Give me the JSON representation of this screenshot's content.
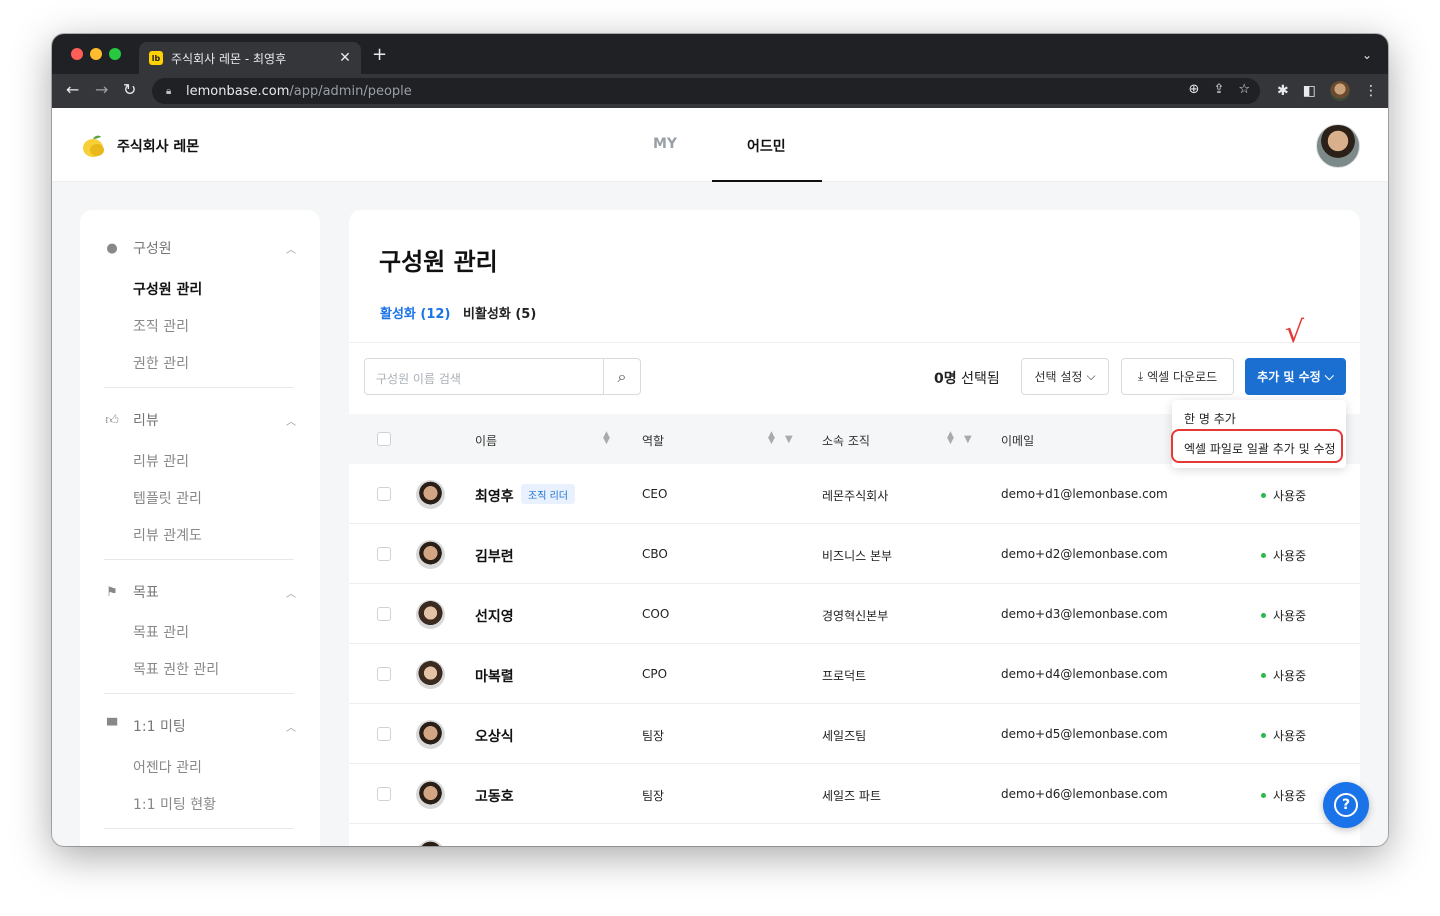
{
  "browser": {
    "tab_title": "주식회사 레몬 - 최영후",
    "tab_favicon": "lb",
    "url_host": "lemonbase.com",
    "url_path": "/app/admin/people"
  },
  "header": {
    "company": "주식회사 레몬",
    "nav": [
      {
        "label": "MY",
        "active": false
      },
      {
        "label": "어드민",
        "active": true
      }
    ]
  },
  "sidebar": {
    "sections": [
      {
        "label": "구성원",
        "icon": "person-icon",
        "items": [
          "구성원 관리",
          "조직 관리",
          "권한 관리"
        ],
        "active_item": 0
      },
      {
        "label": "리뷰",
        "icon": "thumbs-up-icon",
        "items": [
          "리뷰 관리",
          "템플릿 관리",
          "리뷰 관계도"
        ]
      },
      {
        "label": "목표",
        "icon": "flag-icon",
        "items": [
          "목표 관리",
          "목표 권한 관리"
        ]
      },
      {
        "label": "1:1 미팅",
        "icon": "chat-icon",
        "items": [
          "어젠다 관리",
          "1:1 미팅 현황"
        ]
      }
    ]
  },
  "main": {
    "title": "구성원 관리",
    "tabs": [
      {
        "label": "활성화 (12)",
        "active": true
      },
      {
        "label": "비활성화 (5)",
        "active": false
      }
    ],
    "search_placeholder": "구성원 이름 검색",
    "selected_count": "0명",
    "selected_suffix": " 선택됨",
    "buttons": {
      "select_settings": "선택 설정",
      "excel_download": "엑셀 다운로드",
      "add_edit": "추가 및 수정"
    },
    "dropdown": [
      "한 명 추가",
      "엑셀 파일로 일괄 추가 및 수정"
    ],
    "columns": [
      "이름",
      "역할",
      "소속 조직",
      "이메일"
    ],
    "rows": [
      {
        "name": "최영후",
        "badge": "조직 리더",
        "role": "CEO",
        "org": "레몬주식회사",
        "email": "demo+d1@lemonbase.com",
        "status": "사용중"
      },
      {
        "name": "김부련",
        "role": "CBO",
        "org": "비즈니스 본부",
        "email": "demo+d2@lemonbase.com",
        "status": "사용중"
      },
      {
        "name": "선지영",
        "role": "COO",
        "org": "경영혁신본부",
        "email": "demo+d3@lemonbase.com",
        "status": "사용중"
      },
      {
        "name": "마복렬",
        "role": "CPO",
        "org": "프로덕트",
        "email": "demo+d4@lemonbase.com",
        "status": "사용중"
      },
      {
        "name": "오상식",
        "role": "팀장",
        "org": "세일즈팀",
        "email": "demo+d5@lemonbase.com",
        "status": "사용중"
      },
      {
        "name": "고동호",
        "role": "팀장",
        "org": "세일즈 파트",
        "email": "demo+d6@lemonbase.com",
        "status": "사용중"
      }
    ]
  },
  "colors": {
    "accent": "#1a6fd1",
    "highlight": "#e53935",
    "status_active": "#2bb84d"
  }
}
